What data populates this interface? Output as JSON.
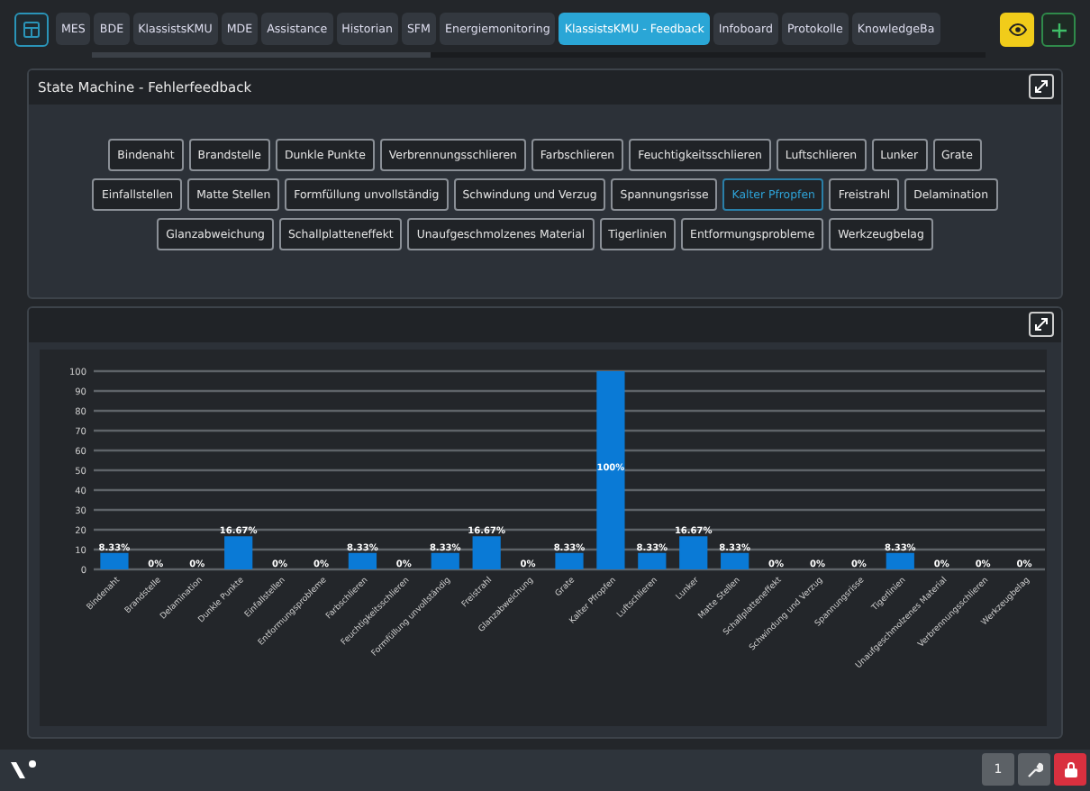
{
  "tabs": [
    {
      "label": "MES",
      "selected": false
    },
    {
      "label": "BDE",
      "selected": false
    },
    {
      "label": "KlassistsKMU",
      "selected": false
    },
    {
      "label": "MDE",
      "selected": false
    },
    {
      "label": "Assistance",
      "selected": false
    },
    {
      "label": "Historian",
      "selected": false
    },
    {
      "label": "SFM",
      "selected": false
    },
    {
      "label": "Energiemonitoring",
      "selected": false
    },
    {
      "label": "KlassistsKMU - Feedback",
      "selected": true
    },
    {
      "label": "Infoboard",
      "selected": false
    },
    {
      "label": "Protokolle",
      "selected": false
    },
    {
      "label": "KnowledgeBa",
      "selected": false
    }
  ],
  "feedback_panel": {
    "title": "State Machine - Fehlerfeedback",
    "defect_rows": [
      [
        {
          "label": "Bindenaht",
          "selected": false
        },
        {
          "label": "Brandstelle",
          "selected": false
        },
        {
          "label": "Dunkle Punkte",
          "selected": false
        },
        {
          "label": "Verbrennungsschlieren",
          "selected": false
        },
        {
          "label": "Farbschlieren",
          "selected": false
        },
        {
          "label": "Feuchtigkeitsschlieren",
          "selected": false
        },
        {
          "label": "Luftschlieren",
          "selected": false
        },
        {
          "label": "Lunker",
          "selected": false
        },
        {
          "label": "Grate",
          "selected": false
        }
      ],
      [
        {
          "label": "Einfallstellen",
          "selected": false
        },
        {
          "label": "Matte Stellen",
          "selected": false
        },
        {
          "label": "Formfüllung unvollständig",
          "selected": false
        },
        {
          "label": "Schwindung und Verzug",
          "selected": false
        },
        {
          "label": "Spannungsrisse",
          "selected": false
        },
        {
          "label": "Kalter Pfropfen",
          "selected": true
        },
        {
          "label": "Freistrahl",
          "selected": false
        },
        {
          "label": "Delamination",
          "selected": false
        }
      ],
      [
        {
          "label": "Glanzabweichung",
          "selected": false
        },
        {
          "label": "Schallplatteneffekt",
          "selected": false
        },
        {
          "label": "Unaufgeschmolzenes Material",
          "selected": false
        },
        {
          "label": "Tigerlinien",
          "selected": false
        },
        {
          "label": "Entformungsprobleme",
          "selected": false
        },
        {
          "label": "Werkzeugbelag",
          "selected": false
        }
      ]
    ]
  },
  "chart_panel": {
    "chart_data": {
      "type": "bar",
      "categories": [
        "Bindenaht",
        "Brandstelle",
        "Delamination",
        "Dunkle Punkte",
        "Einfallstellen",
        "Entformungsprobleme",
        "Farbschlieren",
        "Feuchtigkeitsschlieren",
        "Formfüllung unvollständig",
        "Freistrahl",
        "Glanzabweichung",
        "Grate",
        "Kalter Pfropfen",
        "Luftschlieren",
        "Lunker",
        "Matte Stellen",
        "Schallplatteneffekt",
        "Schwindung und Verzug",
        "Spannungsrisse",
        "Tigerlinien",
        "Unaufgeschmolzenes Material",
        "Verbrennungsschlieren",
        "Werkzeugbelag"
      ],
      "series": [
        {
          "color": "#0a7ad6",
          "values": [
            8.3,
            0,
            0,
            16.7,
            0,
            0,
            8.3,
            0,
            8.3,
            16.7,
            0,
            8.3,
            100,
            8.3,
            16.7,
            8.3,
            0,
            0,
            0,
            8.3,
            0,
            0,
            0
          ]
        }
      ],
      "ylim": [
        0,
        100
      ],
      "grid": true,
      "yticks": [
        0,
        10,
        20,
        30,
        40,
        50,
        60,
        70,
        80,
        90,
        100
      ],
      "value_labels": [
        "8.33%",
        "0%",
        "0%",
        "16.67%",
        "0%",
        "0%",
        "8.33%",
        "0%",
        "8.33%",
        "16.67%",
        "0%",
        "8.33%",
        "100%",
        "8.33%",
        "16.67%",
        "8.33%",
        "0%",
        "0%",
        "0%",
        "8.33%",
        "0%",
        "0%",
        "0%"
      ]
    }
  },
  "footer": {
    "page_number": "1"
  }
}
